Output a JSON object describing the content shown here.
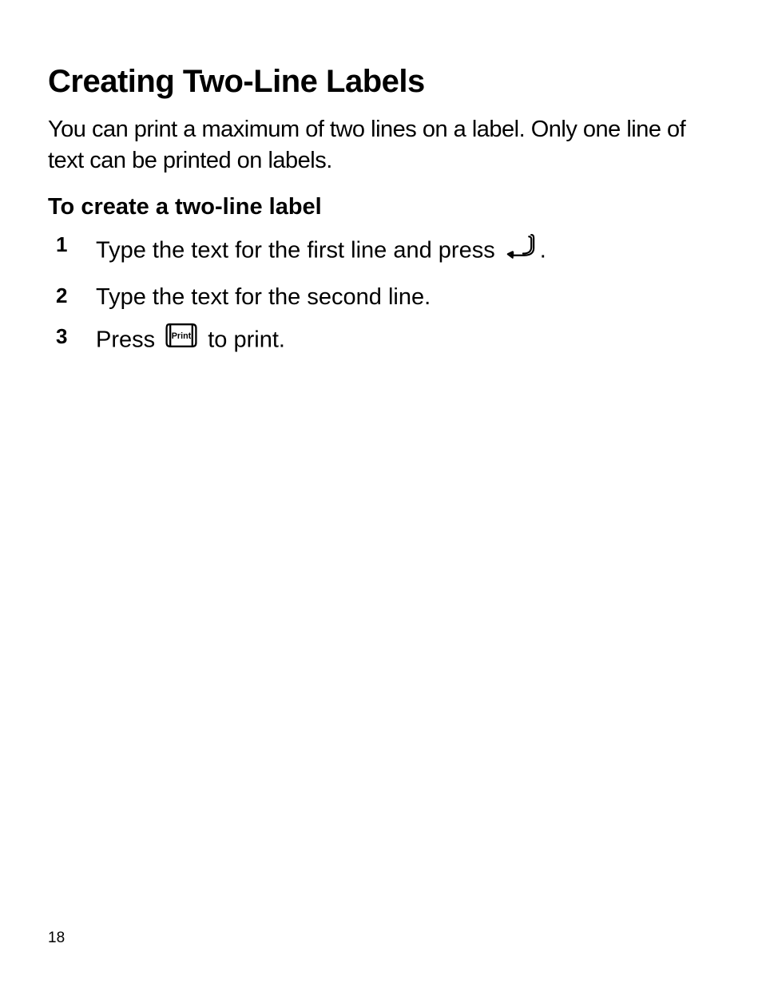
{
  "heading": "Creating Two-Line Labels",
  "intro": "You can print a maximum of two lines on a label. Only one line of text can be printed on  labels.",
  "subhead": "To create a two-line label",
  "steps": {
    "s1": {
      "num": "1",
      "preText": "Type the text for the first line and press ",
      "postText": "."
    },
    "s2": {
      "num": "2",
      "text": "Type the text for the second line."
    },
    "s3": {
      "num": "3",
      "preText": "Press ",
      "postText": " to print."
    }
  },
  "print_key_label": "Print",
  "page_number": "18"
}
